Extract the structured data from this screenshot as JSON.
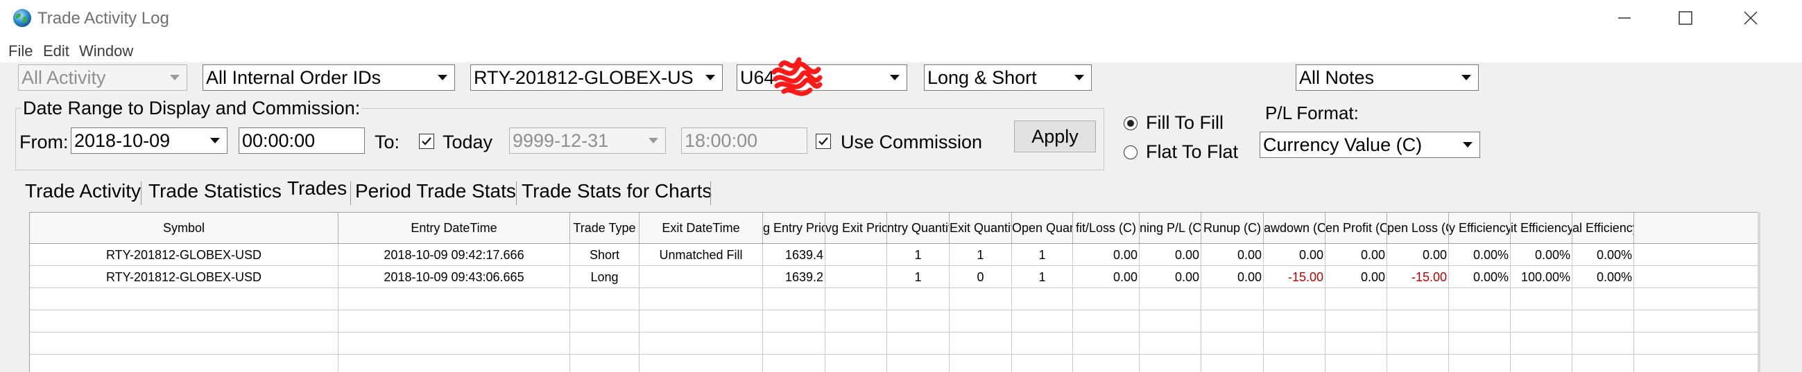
{
  "window": {
    "title": "Trade Activity Log",
    "controls": [
      "minimize",
      "maximize",
      "close"
    ]
  },
  "menu": [
    "File",
    "Edit",
    "Window"
  ],
  "filters": {
    "activity": "All Activity",
    "order_ids": "All Internal Order IDs",
    "symbol": "RTY-201812-GLOBEX-US",
    "account": "U64",
    "direction": "Long & Short",
    "notes": "All Notes"
  },
  "date_range": {
    "group_title": "Date Range to Display and Commission:",
    "from_label": "From:",
    "from_date": "2018-10-09",
    "from_time": "00:00:00",
    "to_label": "To:",
    "today_label": "Today",
    "today_checked": true,
    "to_date": "9999-12-31",
    "to_time": "18:00:00",
    "use_commission_label": "Use Commission",
    "use_commission_checked": true,
    "apply_label": "Apply"
  },
  "pl_options": {
    "fill_to_fill": "Fill To Fill",
    "flat_to_flat": "Flat To Flat",
    "selected": "fill_to_fill",
    "format_label": "P/L Format:",
    "format_value": "Currency Value (C)"
  },
  "tabs": [
    {
      "label": "Trade Activity",
      "active": false
    },
    {
      "label": "Trade Statistics",
      "active": false
    },
    {
      "label": "Trades",
      "active": true
    },
    {
      "label": "Period Trade Stats",
      "active": false
    },
    {
      "label": "Trade Stats for Charts",
      "active": false
    }
  ],
  "table": {
    "columns": [
      "Symbol",
      "Entry DateTime",
      "Trade Type",
      "Exit DateTime",
      "Entry Price",
      "Avg Exit Price",
      "Entry Quantity",
      "Exit Quantity",
      "Open Quantity",
      "Profit/Loss (C)",
      "Running P/L (C)",
      "Runup (C)",
      "Drawdown (C)",
      "Open Profit (C)",
      "Open Loss (C)",
      "Entry Efficiency",
      "Exit Efficiency",
      "Total Efficiency"
    ],
    "header_display": [
      "Symbol",
      "Entry DateTime",
      "Trade Type",
      "Exit DateTime",
      "g Entry Price",
      "vg Exit Price",
      "ntry Quantit",
      "Exit Quantity",
      "Open Quan",
      "fit/Loss (C)",
      "ning P/L (C)",
      "Runup (C)",
      "awdown (C)",
      "en Profit (C)",
      "pen Loss (C)",
      "y Efficiency",
      "it Efficiency",
      "al Efficiency"
    ],
    "rows": [
      [
        "RTY-201812-GLOBEX-USD",
        "2018-10-09  09:42:17.666",
        "Short",
        "Unmatched Fill",
        "1639.4",
        "",
        "1",
        "1",
        "1",
        "0.00",
        "0.00",
        "0.00",
        "0.00",
        "0.00",
        "0.00",
        "0.00%",
        "0.00%",
        "0.00%"
      ],
      [
        "RTY-201812-GLOBEX-USD",
        "2018-10-09  09:43:06.665",
        "Long",
        "",
        "1639.2",
        "",
        "1",
        "0",
        "1",
        "0.00",
        "0.00",
        "0.00",
        "-15.00",
        "0.00",
        "-15.00",
        "0.00%",
        "100.00%",
        "0.00%"
      ]
    ],
    "empty_rows": 4
  },
  "colors": {
    "negative": "#c00000",
    "redaction": "#ff1a1a",
    "panel_bg": "#f0f0f0"
  }
}
